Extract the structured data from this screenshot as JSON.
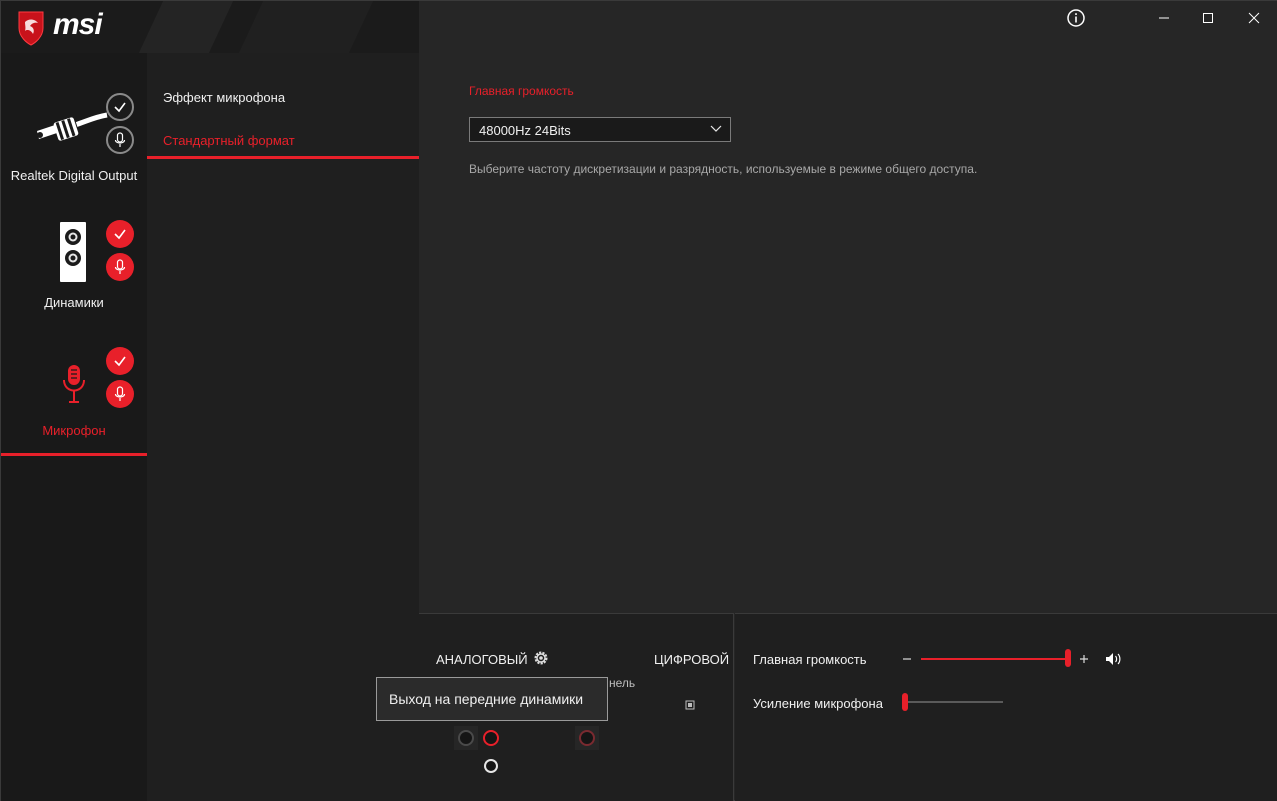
{
  "app": {
    "brand": "msi"
  },
  "titlebar": {
    "info_icon": "info-icon",
    "minimize_icon": "minimize-icon",
    "maximize_icon": "maximize-icon",
    "close_icon": "close-icon"
  },
  "devices": [
    {
      "label": "Realtek Digital Output",
      "active": false
    },
    {
      "label": "Динамики",
      "active": false
    },
    {
      "label": "Микрофон",
      "active": true
    }
  ],
  "submenu": {
    "items": [
      {
        "label": "Эффект микрофона",
        "active": false
      },
      {
        "label": "Стандартный формат",
        "active": true
      }
    ]
  },
  "main": {
    "section_title": "Главная громкость",
    "format_select": {
      "value": "48000Hz 24Bits"
    },
    "description": "Выберите частоту дискретизации и разрядность, используемые в режиме общего доступа."
  },
  "bottom": {
    "analog_label": "АНАЛОГОВЫЙ",
    "digital_label": "ЦИФРОВОЙ",
    "partial_label": "нель",
    "tooltip": "Выход на передние динамики",
    "master_volume": {
      "label": "Главная громкость",
      "value": 1.0
    },
    "mic_boost": {
      "label": "Усиление микрофона",
      "value": 0.0
    }
  },
  "colors": {
    "accent": "#e8202a",
    "background": "#262626",
    "rail": "#191919"
  }
}
